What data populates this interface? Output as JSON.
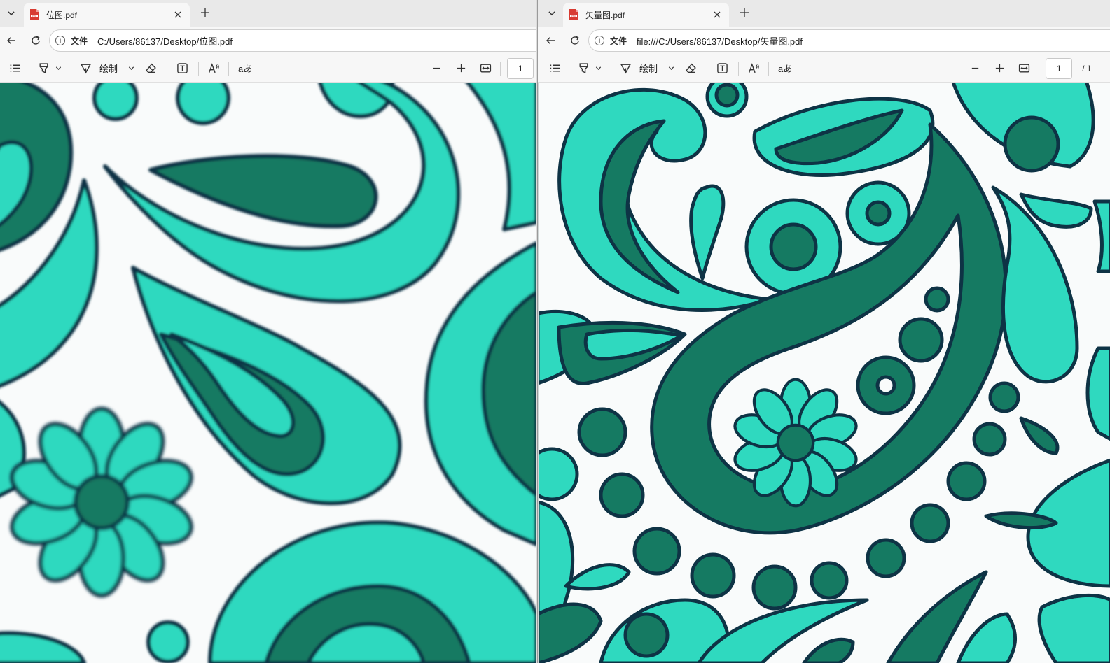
{
  "left_window": {
    "tab": {
      "title": "位图.pdf"
    },
    "address": {
      "scheme_label": "文件",
      "url": "C:/Users/86137/Desktop/位图.pdf"
    },
    "toolbar": {
      "draw_label": "绘制",
      "read_aloud_label": "aあ",
      "page_number": "1"
    }
  },
  "right_window": {
    "tab": {
      "title": "矢量图.pdf"
    },
    "address": {
      "scheme_label": "文件",
      "url": "file:///C:/Users/86137/Desktop/矢量图.pdf"
    },
    "toolbar": {
      "draw_label": "绘制",
      "read_aloud_label": "aあ",
      "page_number": "1",
      "page_total": "/ 1"
    }
  },
  "icons": {
    "tab_list": "chevron-down-icon",
    "pdf_file": "pdf-file-icon",
    "close": "close-icon",
    "new_tab": "plus-icon",
    "back": "arrow-left-icon",
    "refresh": "refresh-icon",
    "info": "info-icon",
    "contents": "list-icon",
    "highlight": "highlighter-icon",
    "draw": "pen-icon",
    "erase": "eraser-icon",
    "text": "text-box-icon",
    "read_aloud": "read-aloud-icon",
    "zoom_out": "minus-icon",
    "zoom_in": "plus-icon",
    "fit_width": "fit-width-icon"
  },
  "colors": {
    "pattern_light": "#2fd9bf",
    "pattern_dark": "#157a62",
    "pattern_outline": "#0e3345",
    "pattern_background": "#f9fbfb",
    "chrome_bg": "#f7f7f7",
    "tabstrip_bg": "#e9e9e9"
  }
}
